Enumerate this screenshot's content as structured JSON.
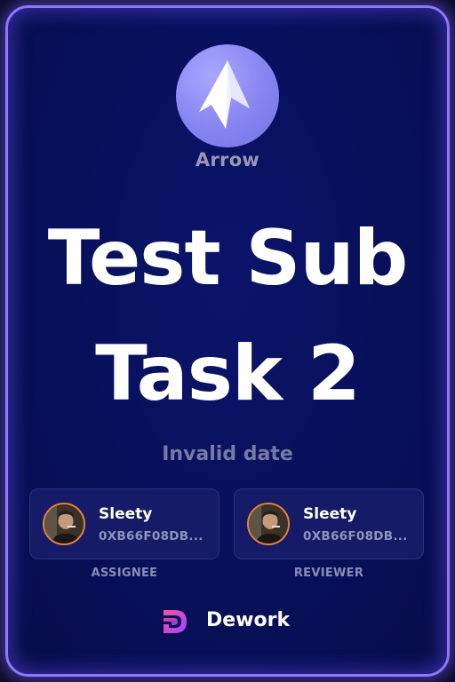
{
  "organization": {
    "name": "Arrow",
    "logo_icon": "arrow-icon"
  },
  "task": {
    "title": "Test Sub Task 2",
    "date": "Invalid date"
  },
  "assignee": {
    "name": "Sleety",
    "address": "0XB66F08DB...",
    "role": "ASSIGNEE",
    "avatar": "user-avatar"
  },
  "reviewer": {
    "name": "Sleety",
    "address": "0XB66F08DB...",
    "role": "REVIEWER",
    "avatar": "user-avatar"
  },
  "brand": {
    "name": "Dework",
    "logo_icon": "dework-logo-icon"
  },
  "colors": {
    "card_border": "#8e76ff",
    "background": "#08105a",
    "logo_circle": "#8684f0",
    "avatar_ring": "#e3833a"
  }
}
